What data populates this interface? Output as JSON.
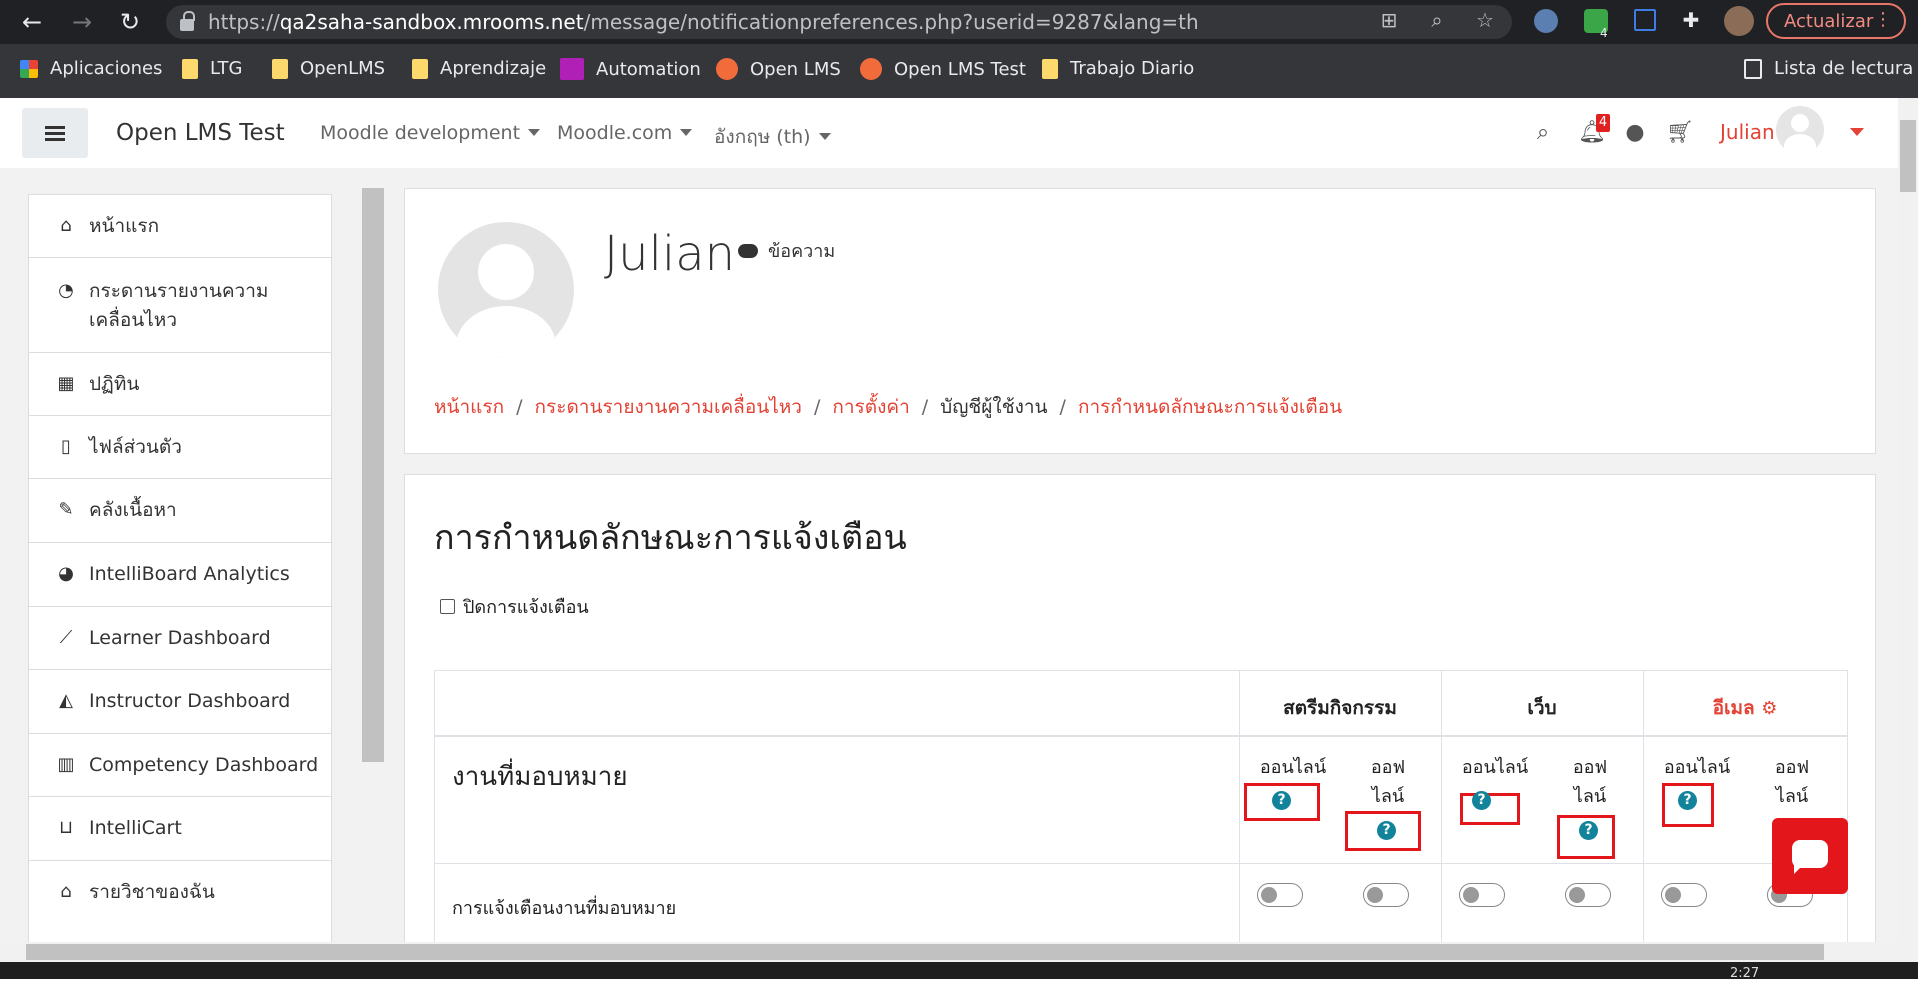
{
  "browser": {
    "url_host": "qa2saha-sandbox.mrooms.net",
    "url_prefix": "https://",
    "url_path": "/message/notificationpreferences.php?userid=9287&lang=th",
    "update_label": "Actualizar",
    "extension_badge": "4",
    "bookmarks": [
      {
        "label": "Aplicaciones",
        "icon": "apps-grid-icon"
      },
      {
        "label": "LTG",
        "icon": "folder-icon"
      },
      {
        "label": "OpenLMS",
        "icon": "folder-icon"
      },
      {
        "label": "Aprendizaje",
        "icon": "folder-icon"
      },
      {
        "label": "Automation",
        "icon": "automation-icon"
      },
      {
        "label": "Open LMS",
        "icon": "openlms-icon"
      },
      {
        "label": "Open LMS Test",
        "icon": "openlms-icon"
      },
      {
        "label": "Trabajo Diario",
        "icon": "folder-icon"
      }
    ],
    "reading_list": "Lista de lectura"
  },
  "navbar": {
    "site_name": "Open LMS Test",
    "menus": [
      "Moodle development",
      "Moodle.com",
      "อังกฤษ (th)"
    ],
    "notification_count": "4",
    "user_name": "Julian"
  },
  "drawer": {
    "items": [
      {
        "label": "หน้าแรก",
        "icon": "home-icon"
      },
      {
        "label": "กระดานรายงานความเคลื่อนไหว",
        "icon": "dashboard-icon"
      },
      {
        "label": "ปฏิทิน",
        "icon": "calendar-icon"
      },
      {
        "label": "ไฟล์ส่วนตัว",
        "icon": "file-icon"
      },
      {
        "label": "คลังเนื้อหา",
        "icon": "paintbrush-icon"
      },
      {
        "label": "IntelliBoard Analytics",
        "icon": "pie-chart-icon"
      },
      {
        "label": "Learner Dashboard",
        "icon": "line-chart-icon"
      },
      {
        "label": "Instructor Dashboard",
        "icon": "area-chart-icon"
      },
      {
        "label": "Competency Dashboard",
        "icon": "bar-chart-icon"
      },
      {
        "label": "IntelliCart",
        "icon": "cart-icon"
      },
      {
        "label": "รายวิชาของฉัน",
        "icon": "graduation-cap-icon"
      }
    ]
  },
  "profile": {
    "name": "Julian",
    "message_label": "ข้อความ"
  },
  "breadcrumb": [
    {
      "label": "หน้าแรก",
      "link": true
    },
    {
      "label": "กระดานรายงานความเคลื่อนไหว",
      "link": true
    },
    {
      "label": "การตั้งค่า",
      "link": true
    },
    {
      "label": "บัญชีผู้ใช้งาน",
      "link": false
    },
    {
      "label": "การกำหนดลักษณะการแจ้งเตือน",
      "link": true
    }
  ],
  "main": {
    "heading": "การกำหนดลักษณะการแจ้งเตือน",
    "disable_label": "ปิดการแจ้งเตือน",
    "columns": [
      "สตรีมกิจกรรม",
      "เว็บ",
      "อีเมล"
    ],
    "online_label": "ออนไลน์",
    "offline_line1": "ออฟ",
    "offline_line2": "ไลน์",
    "section": "งานที่มอบหมาย",
    "row_label": "การแจ้งเตือนงานที่มอบหมาย",
    "toggles": [
      false,
      false,
      false,
      false,
      false,
      false
    ],
    "help_glyph": "?"
  },
  "colors": {
    "accent": "#e34234",
    "help": "#11839b",
    "highlight_box": "#e3161c"
  },
  "taskbar_clock": "2:27"
}
